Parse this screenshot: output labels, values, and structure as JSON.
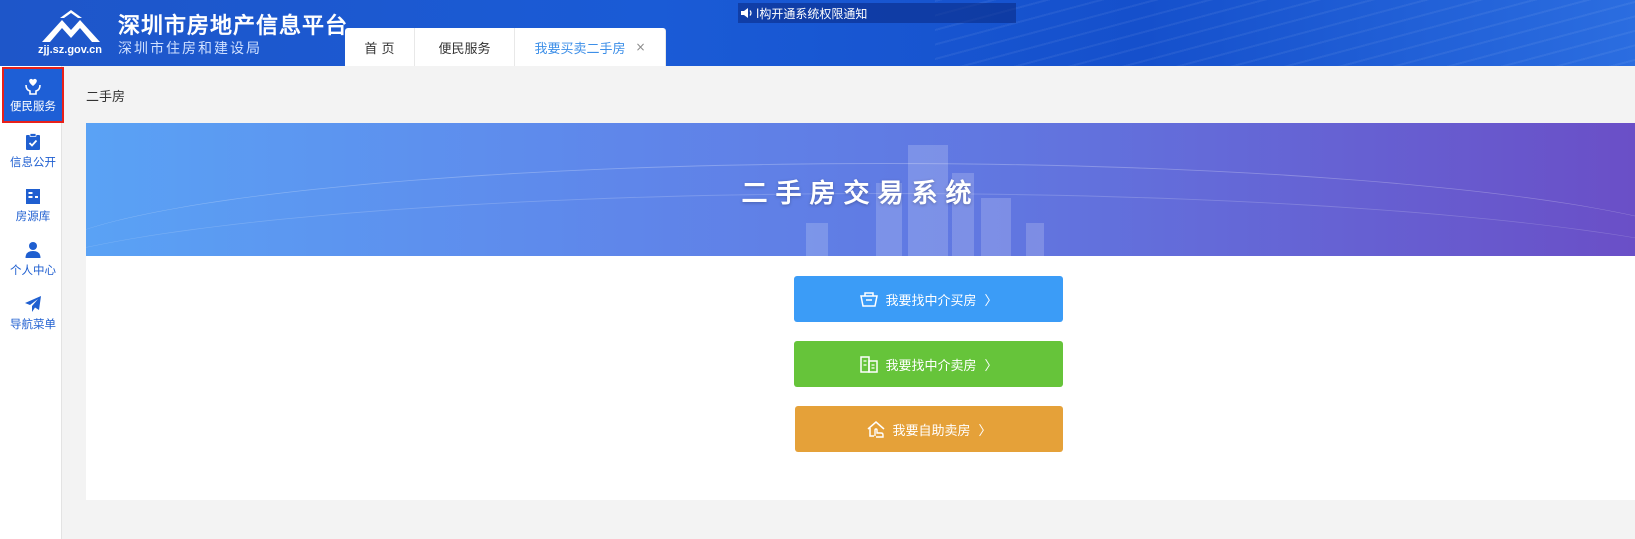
{
  "header": {
    "logo_text": "zjj.sz.gov.cn",
    "title": "深圳市房地产信息平台",
    "subtitle": "深圳市住房和建设局",
    "notice": "l构开通系统权限通知"
  },
  "tabs": [
    {
      "label": "首 页",
      "icon": "none"
    },
    {
      "label": "便民服务",
      "icon": "none"
    },
    {
      "label": "我要买卖二手房",
      "icon": "close-icon",
      "close": "×"
    }
  ],
  "sidebar": {
    "items": [
      {
        "label": "便民服务",
        "icon": "heart-hand-icon",
        "active": true
      },
      {
        "label": "信息公开",
        "icon": "clipboard-check-icon"
      },
      {
        "label": "房源库",
        "icon": "building-icon"
      },
      {
        "label": "个人中心",
        "icon": "user-icon"
      },
      {
        "label": "导航菜单",
        "icon": "paper-plane-icon"
      }
    ]
  },
  "breadcrumb": "二手房",
  "banner": {
    "title": "二手房交易系统"
  },
  "buttons": [
    {
      "label": "我要找中介买房",
      "arrow": "〉",
      "icon": "basket-icon",
      "color": "#3b9cf7"
    },
    {
      "label": "我要找中介卖房",
      "arrow": "〉",
      "icon": "building-doc-icon",
      "color": "#66c43a"
    },
    {
      "label": "我要自助卖房",
      "arrow": "〉",
      "icon": "house-hand-icon",
      "color": "#e5a139"
    }
  ],
  "colors": {
    "header_blue": "#1a5bd6",
    "sidebar_accent": "#1f5fd0",
    "active_outline": "#e8201a"
  }
}
